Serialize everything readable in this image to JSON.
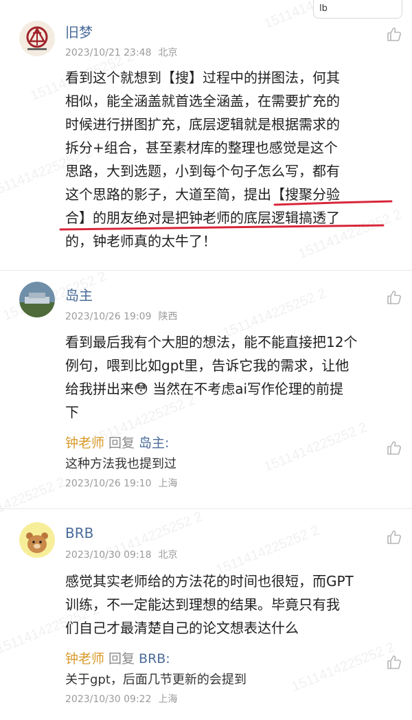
{
  "top_box": {
    "text": "lb"
  },
  "watermark_text": "1511414225252 2",
  "comments": [
    {
      "username": "旧梦",
      "time": "2023/10/21 23:48",
      "location": "北京",
      "lines": [
        "看到这个就想到【搜】过程中的拼图法，何其",
        "相似，能全涵盖就首选全涵盖，在需要扩充的",
        "时候进行拼图扩充，底层逻辑就是根据需求的",
        "拆分+组合，甚至素材库的整理也感觉是这个",
        "思路，大到选题，小到每个句子怎么写，都有",
        "这个思路的影子，大道至简，提出【搜聚分验",
        "合】的朋友绝对是把钟老师的底层逻辑搞透了",
        "的，钟老师真的太牛了！"
      ]
    },
    {
      "username": "岛主",
      "time": "2023/10/26 19:09",
      "location": "陕西",
      "lines": [
        "看到最后我有个大胆的想法，能不能直接把12个",
        "例句，喂到比如gpt里，告诉它我的需求，让他",
        "给我拼出来😳 当然在不考虑ai写作伦理的前提",
        "下"
      ],
      "reply": {
        "name": "钟老师",
        "word": "回复",
        "target": "岛主:",
        "text": "这种方法我也提到过",
        "time": "2023/10/26 19:10",
        "location": "上海"
      }
    },
    {
      "username": "BRB",
      "time": "2023/10/30 09:18",
      "location": "北京",
      "lines": [
        "感觉其实老师给的方法花的时间也很短，而GPT",
        "训练，不一定能达到理想的结果。毕竟只有我",
        "们自己才最清楚自己的论文想表达什么"
      ],
      "reply": {
        "name": "钟老师",
        "word": "回复",
        "target": "BRB:",
        "text": "关于gpt，后面几节更新的会提到",
        "time": "2023/10/30 09:22",
        "location": "上海"
      }
    }
  ],
  "colors": {
    "username": "#4a6b99",
    "reply_name": "#d99a2b",
    "meta": "#9a9a9a",
    "underline": "#d8263a"
  }
}
